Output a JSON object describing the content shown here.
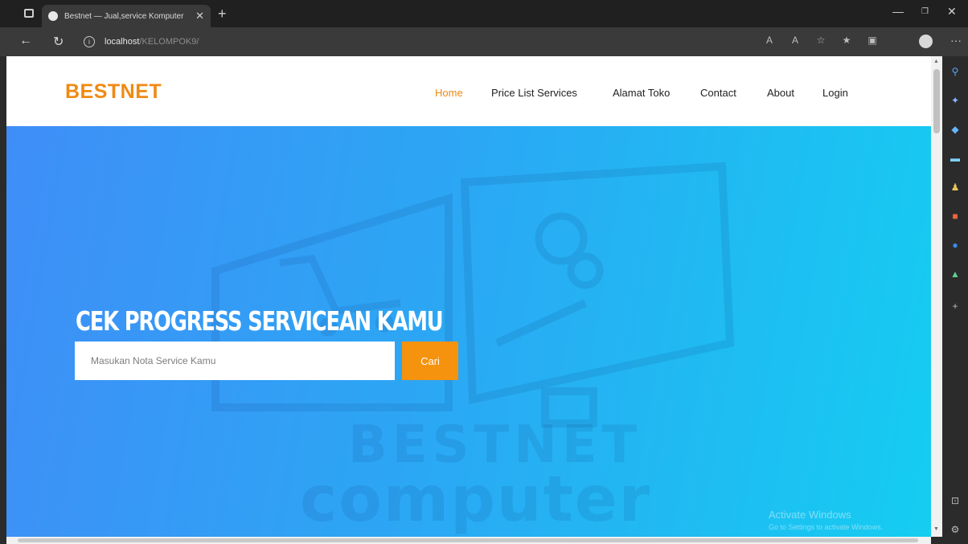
{
  "browser": {
    "tab_title": "Bestnet — Jual,service Komputer",
    "url_host": "localhost",
    "url_path": "/KELOMPOK9/",
    "new_tab": "+",
    "close_tab": "✕"
  },
  "site": {
    "logo": "BESTNET",
    "nav": [
      {
        "label": "Home",
        "active": true
      },
      {
        "label": "Price List Services",
        "active": false
      },
      {
        "label": "Alamat Toko",
        "active": false
      },
      {
        "label": "Contact",
        "active": false
      },
      {
        "label": "About",
        "active": false
      },
      {
        "label": "Login",
        "active": false
      }
    ]
  },
  "hero": {
    "title": "CEK PROGRESS SERVICEAN KAMU",
    "search_placeholder": "Masukan Nota Service Kamu",
    "search_button": "Cari",
    "watermark_line1": "BESTNET",
    "watermark_line2": "computer"
  },
  "windows_notice": {
    "title": "Activate Windows",
    "subtitle": "Go to Settings to activate Windows."
  },
  "colors": {
    "accent": "#f08a12",
    "hero_start": "#3f8ef7",
    "hero_end": "#15cdf1"
  }
}
